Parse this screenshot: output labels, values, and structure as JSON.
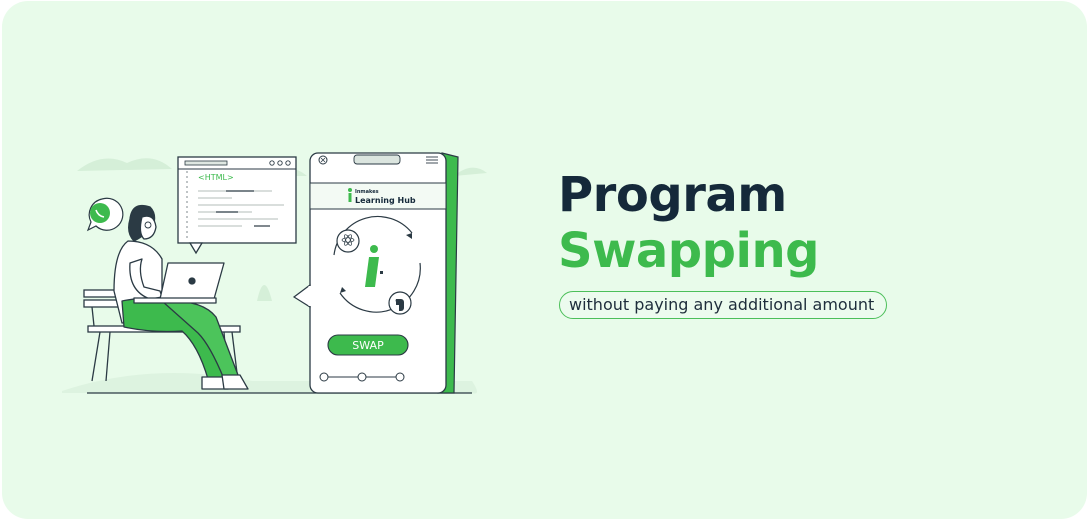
{
  "headline": {
    "line1": "Program",
    "line2": "Swapping",
    "tagline": "without paying any additional amount"
  },
  "illustration": {
    "code_window_tag": "<HTML>",
    "phone": {
      "brand_line1": "Inmakes",
      "brand_line2": "Learning Hub",
      "swap_button": "SWAP",
      "icon_top": "react-icon",
      "icon_bottom": "python-icon"
    },
    "chat_bubble_icon": "whatsapp-icon"
  },
  "colors": {
    "background": "#e8fbea",
    "dark_text": "#15293a",
    "accent_green": "#3dba4d",
    "outline": "#2b3a44"
  }
}
